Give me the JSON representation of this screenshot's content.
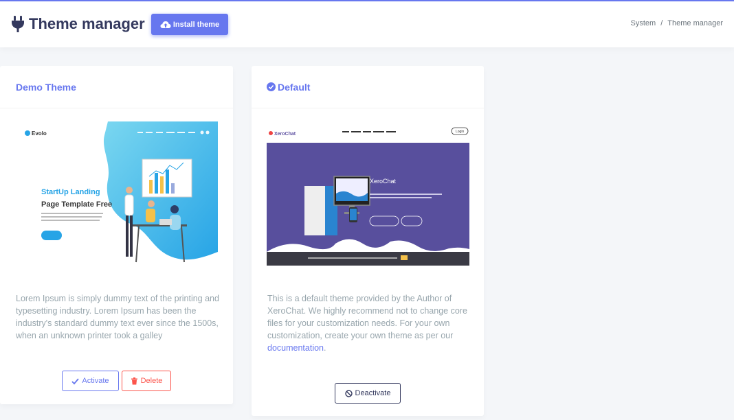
{
  "header": {
    "title": "Theme manager",
    "install_label": "Install theme",
    "breadcrumb": [
      "System",
      "Theme manager"
    ]
  },
  "themes": [
    {
      "name": "Demo Theme",
      "is_default": false,
      "preview": {
        "brand": "Evolo",
        "headline_1": "StartUp Landing",
        "headline_2": "Page Template Free"
      },
      "description": "Lorem Ipsum is simply dummy text of the printing and typesetting industry. Lorem Ipsum has been the industry's standard dummy text ever since the 1500s, when an unknown printer took a galley",
      "actions": [
        "Activate",
        "Delete"
      ]
    },
    {
      "name": "Default",
      "is_default": true,
      "preview": {
        "brand": "XeroChat",
        "login": "Login",
        "hero_title": "XeroChat"
      },
      "description_text": "This is a default theme provided by the Author of XeroChat. We highly recommend not to change core files for your customization needs. For your own customization, create your own theme as per our ",
      "description_link": "documentation",
      "description_end": ".",
      "actions": [
        "Deactivate"
      ]
    }
  ],
  "colors": {
    "primary": "#6777ef",
    "danger": "#fc544b",
    "dark": "#34395e",
    "muted": "#98a6ad"
  },
  "icons": [
    "plug-icon",
    "cloud-upload-icon",
    "check-circle-icon",
    "check-icon",
    "trash-icon",
    "ban-icon"
  ]
}
